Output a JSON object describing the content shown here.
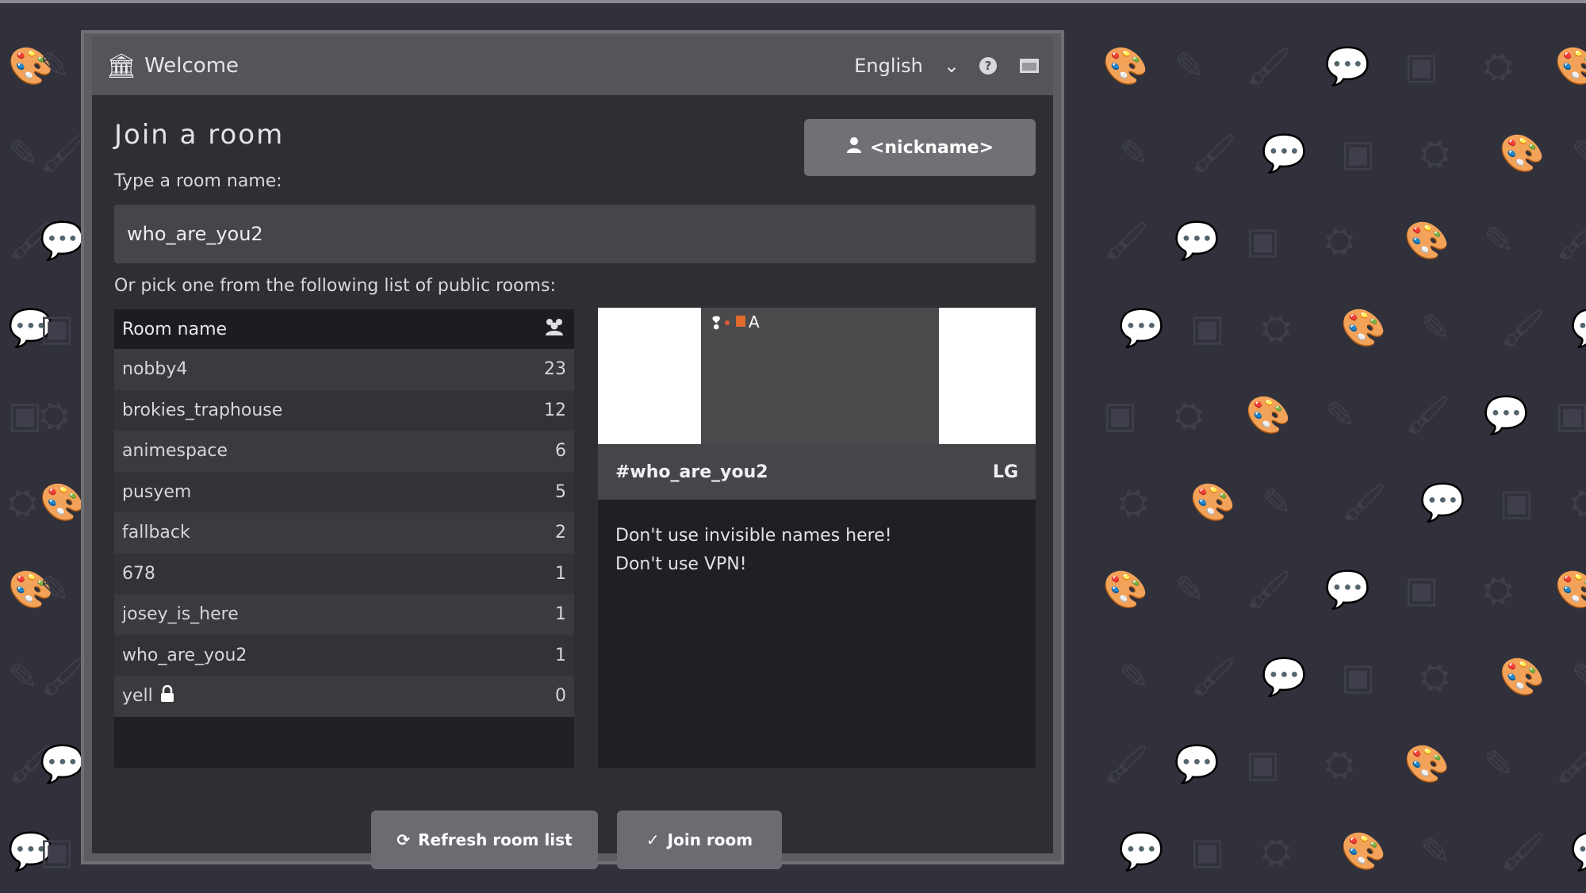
{
  "window": {
    "title": "Welcome",
    "title_icon": "building-icon",
    "language": "English"
  },
  "join": {
    "heading": "Join a room",
    "user_button_label": "<nickname>",
    "type_label": "Type a room name:",
    "room_input_value": "who_are_you2",
    "pick_label": "Or pick one from the following list of public rooms:"
  },
  "room_list": {
    "header_name": "Room name",
    "header_users_icon": "users-icon",
    "rooms": [
      {
        "name": "nobby4",
        "users": "23"
      },
      {
        "name": "brokies_traphouse",
        "users": "12"
      },
      {
        "name": "animespace",
        "users": "6"
      },
      {
        "name": "pusyem",
        "users": "5"
      },
      {
        "name": "fallback",
        "users": "2"
      },
      {
        "name": "678",
        "users": "1"
      },
      {
        "name": "josey_is_here",
        "users": "1"
      },
      {
        "name": "who_are_you2",
        "users": "1"
      },
      {
        "name": "yell",
        "users": "0",
        "locked": true
      }
    ]
  },
  "preview": {
    "room_name": "#who_are_you2",
    "badge": "LG",
    "description_lines": [
      "Don't use invisible names here!",
      "Don't use VPN!"
    ]
  },
  "buttons": {
    "refresh_label": "Refresh room list",
    "join_label": "Join room"
  }
}
